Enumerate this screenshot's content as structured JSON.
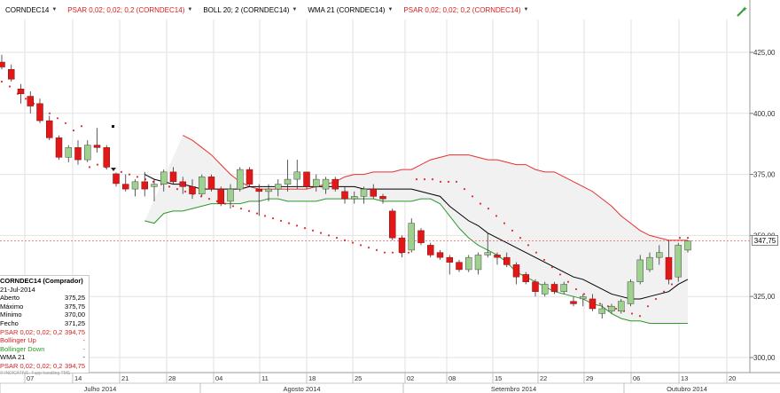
{
  "toolbar": {
    "items": [
      {
        "label": "CORNDEC14",
        "color": "#000000"
      },
      {
        "label": "PSAR 0,02; 0,02; 0,2 (CORNDEC14)",
        "color": "#d42020"
      },
      {
        "label": "BOLL 20; 2 (CORNDEC14)",
        "color": "#000000"
      },
      {
        "label": "WMA 21 (CORNDEC14)",
        "color": "#000000"
      },
      {
        "label": "PSAR 0,02; 0,02; 0,2 (CORNDEC14)",
        "color": "#d42020"
      }
    ],
    "wand_icon": "magic-wand-icon"
  },
  "info_panel": {
    "title": "CORNDEC14 (Comprador)",
    "date": "21-Jul-2014",
    "rows": [
      {
        "label": "Aberto",
        "value": "375,25",
        "color": "#000000"
      },
      {
        "label": "Máximo",
        "value": "375,75",
        "color": "#000000"
      },
      {
        "label": "Mínimo",
        "value": "370,00",
        "color": "#000000"
      },
      {
        "label": "Fecho",
        "value": "371,25",
        "color": "#000000"
      },
      {
        "label": "PSAR 0,02; 0,02; 0,2",
        "value": "394,75",
        "color": "#d42020"
      },
      {
        "label": "Bollinger Up",
        "value": "-",
        "color": "#d42020"
      },
      {
        "label": "Bollinger Down",
        "value": "-",
        "color": "#2a9a2a"
      },
      {
        "label": "WMA 21",
        "value": "-",
        "color": "#000000"
      },
      {
        "label": "PSAR 0,02; 0,02; 0,2",
        "value": "394,75",
        "color": "#d42020"
      }
    ]
  },
  "watermark": "© INDICATIVE. Fupp handling TMS",
  "last_price": "347,75",
  "colors": {
    "up": "#9ed08e",
    "down": "#e01818",
    "boll_up": "#e83030",
    "boll_down": "#2a9a2a",
    "wma": "#000000",
    "psar": "#e03030",
    "band_fill": "#f1f1f1",
    "grid": "#e2e2e2"
  },
  "chart_data": {
    "type": "candlestick",
    "symbol": "CORNDEC14",
    "y_axis": {
      "min": 300,
      "max": 425,
      "ticks": [
        "300,00",
        "325,00",
        "350,00",
        "375,00",
        "400,00",
        "425,00"
      ],
      "tick_values": [
        300,
        325,
        350,
        375,
        400,
        425
      ],
      "position": "right"
    },
    "x_axis": {
      "day_ticks": [
        "07",
        "14",
        "21",
        "28",
        "04",
        "11",
        "18",
        "25",
        "02",
        "08",
        "15",
        "22",
        "29",
        "06",
        "13",
        "20"
      ],
      "months": [
        "Julho 2014",
        "Agosto 2014",
        "Setembro 2014",
        "Outubro 2014"
      ]
    },
    "candles": [
      {
        "o": 421,
        "h": 424,
        "l": 418,
        "c": 419
      },
      {
        "o": 418,
        "h": 420,
        "l": 413,
        "c": 414
      },
      {
        "o": 410,
        "h": 412,
        "l": 404,
        "c": 408
      },
      {
        "o": 407,
        "h": 409,
        "l": 400,
        "c": 403
      },
      {
        "o": 404,
        "h": 406,
        "l": 396,
        "c": 397
      },
      {
        "o": 397,
        "h": 399,
        "l": 389,
        "c": 390
      },
      {
        "o": 390,
        "h": 391,
        "l": 381,
        "c": 382
      },
      {
        "o": 382,
        "h": 387,
        "l": 380,
        "c": 386
      },
      {
        "o": 386,
        "h": 389,
        "l": 379,
        "c": 381
      },
      {
        "o": 381,
        "h": 389,
        "l": 380,
        "c": 387
      },
      {
        "o": 387,
        "h": 394,
        "l": 384,
        "c": 386
      },
      {
        "o": 386,
        "h": 387,
        "l": 377,
        "c": 378
      },
      {
        "o": 375.25,
        "h": 375.75,
        "l": 370,
        "c": 371.25
      },
      {
        "o": 371,
        "h": 375,
        "l": 368,
        "c": 369
      },
      {
        "o": 369,
        "h": 373,
        "l": 366,
        "c": 372
      },
      {
        "o": 372,
        "h": 376,
        "l": 366,
        "c": 369
      },
      {
        "o": 370,
        "h": 373,
        "l": 364,
        "c": 371
      },
      {
        "o": 371,
        "h": 377,
        "l": 368,
        "c": 376
      },
      {
        "o": 376,
        "h": 378,
        "l": 371,
        "c": 372
      },
      {
        "o": 372,
        "h": 374,
        "l": 367,
        "c": 370
      },
      {
        "o": 370,
        "h": 373,
        "l": 365,
        "c": 367
      },
      {
        "o": 367,
        "h": 375,
        "l": 366,
        "c": 374
      },
      {
        "o": 374,
        "h": 375,
        "l": 368,
        "c": 369
      },
      {
        "o": 369,
        "h": 370,
        "l": 362,
        "c": 363
      },
      {
        "o": 364,
        "h": 371,
        "l": 361,
        "c": 369
      },
      {
        "o": 369,
        "h": 378,
        "l": 368,
        "c": 377
      },
      {
        "o": 377,
        "h": 378,
        "l": 370,
        "c": 371
      },
      {
        "o": 369,
        "h": 371,
        "l": 358,
        "c": 368
      },
      {
        "o": 368,
        "h": 371,
        "l": 364,
        "c": 369
      },
      {
        "o": 369,
        "h": 373,
        "l": 366,
        "c": 371
      },
      {
        "o": 371,
        "h": 381,
        "l": 368,
        "c": 373
      },
      {
        "o": 373,
        "h": 381,
        "l": 369,
        "c": 376
      },
      {
        "o": 376,
        "h": 376,
        "l": 369,
        "c": 370
      },
      {
        "o": 370,
        "h": 375,
        "l": 368,
        "c": 373
      },
      {
        "o": 369,
        "h": 374,
        "l": 367,
        "c": 373
      },
      {
        "o": 373,
        "h": 374,
        "l": 368,
        "c": 369
      },
      {
        "o": 368,
        "h": 370,
        "l": 363,
        "c": 365
      },
      {
        "o": 365,
        "h": 368,
        "l": 363,
        "c": 366
      },
      {
        "o": 366,
        "h": 370,
        "l": 363,
        "c": 369
      },
      {
        "o": 369,
        "h": 371,
        "l": 365,
        "c": 366
      },
      {
        "o": 366,
        "h": 367,
        "l": 363,
        "c": 365
      },
      {
        "o": 360,
        "h": 361,
        "l": 348,
        "c": 349
      },
      {
        "o": 349,
        "h": 350,
        "l": 341,
        "c": 343
      },
      {
        "o": 344,
        "h": 357,
        "l": 343,
        "c": 355
      },
      {
        "o": 352,
        "h": 353,
        "l": 346,
        "c": 347
      },
      {
        "o": 346,
        "h": 347,
        "l": 341,
        "c": 342
      },
      {
        "o": 343,
        "h": 344,
        "l": 340,
        "c": 341
      },
      {
        "o": 341,
        "h": 342,
        "l": 334,
        "c": 339
      },
      {
        "o": 339,
        "h": 340,
        "l": 335,
        "c": 336
      },
      {
        "o": 336,
        "h": 342,
        "l": 335,
        "c": 341
      },
      {
        "o": 336,
        "h": 343,
        "l": 334,
        "c": 342
      },
      {
        "o": 342,
        "h": 351,
        "l": 341,
        "c": 343
      },
      {
        "o": 342,
        "h": 343,
        "l": 338,
        "c": 341
      },
      {
        "o": 341,
        "h": 343,
        "l": 337,
        "c": 338
      },
      {
        "o": 338,
        "h": 339,
        "l": 330,
        "c": 333
      },
      {
        "o": 334,
        "h": 335,
        "l": 330,
        "c": 331
      },
      {
        "o": 331,
        "h": 332,
        "l": 325,
        "c": 327
      },
      {
        "o": 326,
        "h": 331,
        "l": 325,
        "c": 330
      },
      {
        "o": 330,
        "h": 331,
        "l": 326,
        "c": 327
      },
      {
        "o": 327,
        "h": 331,
        "l": 326,
        "c": 330
      },
      {
        "o": 323,
        "h": 325,
        "l": 321,
        "c": 322
      },
      {
        "o": 324,
        "h": 326,
        "l": 321,
        "c": 325
      },
      {
        "o": 324,
        "h": 326,
        "l": 319,
        "c": 320
      },
      {
        "o": 318,
        "h": 322,
        "l": 316,
        "c": 320
      },
      {
        "o": 319,
        "h": 322,
        "l": 318,
        "c": 321
      },
      {
        "o": 319,
        "h": 324,
        "l": 318,
        "c": 323
      },
      {
        "o": 322,
        "h": 332,
        "l": 321,
        "c": 331
      },
      {
        "o": 331,
        "h": 342,
        "l": 330,
        "c": 340
      },
      {
        "o": 336,
        "h": 343,
        "l": 335,
        "c": 341
      },
      {
        "o": 341,
        "h": 346,
        "l": 338,
        "c": 343
      },
      {
        "o": 341,
        "h": 348,
        "l": 330,
        "c": 332
      },
      {
        "o": 333,
        "h": 347,
        "l": 331,
        "c": 346
      },
      {
        "o": 344,
        "h": 348,
        "l": 343,
        "c": 347.75
      }
    ],
    "bollinger_up": [
      391,
      389,
      386,
      383,
      379,
      375,
      372,
      370,
      369,
      369,
      369,
      369,
      369,
      369,
      370,
      371,
      372,
      374,
      375,
      375,
      376,
      376,
      376,
      377,
      377,
      379,
      381,
      382,
      383,
      383,
      383,
      382,
      381,
      381,
      380,
      379,
      379,
      377,
      376,
      376,
      374,
      372,
      370,
      368,
      365,
      362,
      358,
      355,
      352,
      350,
      349,
      348,
      348,
      348
    ],
    "bollinger_down": [
      356,
      355,
      359,
      360,
      360,
      361,
      362,
      363,
      363,
      363,
      363,
      364,
      364,
      365,
      365,
      364,
      364,
      364,
      364,
      365,
      365,
      365,
      365,
      365,
      365,
      364,
      364,
      364,
      364,
      365,
      365,
      363,
      358,
      353,
      349,
      346,
      344,
      342,
      339,
      335,
      333,
      331,
      329,
      327,
      326,
      325,
      324,
      322,
      321,
      318,
      316,
      315,
      315,
      314,
      314,
      314,
      314,
      314
    ],
    "wma_21": [
      375,
      373,
      372,
      371,
      371,
      370,
      369,
      369,
      369,
      369,
      369,
      370,
      370,
      370,
      370,
      370,
      370,
      370,
      370,
      370,
      370,
      370,
      370,
      369,
      369,
      369,
      369,
      369,
      369,
      368,
      367,
      366,
      362,
      359,
      356,
      354,
      351,
      349,
      347,
      345,
      343,
      341,
      339,
      337,
      335,
      333,
      332,
      330,
      328,
      326,
      325,
      324,
      324,
      325,
      326,
      327,
      330,
      332
    ],
    "psar": [
      413,
      411,
      408,
      406,
      404,
      402,
      400,
      398,
      396,
      393,
      394.75,
      378,
      379,
      378,
      377,
      376,
      375,
      374,
      373,
      372,
      371,
      370,
      369,
      368,
      367,
      366,
      365,
      364,
      363,
      362,
      361,
      360,
      359,
      358,
      357,
      356,
      355,
      354,
      353,
      352,
      351,
      350,
      349,
      348,
      347,
      346,
      345,
      344,
      343,
      343,
      343,
      343,
      373,
      373,
      373,
      372,
      372,
      372,
      369,
      366,
      363,
      361,
      358,
      355,
      352,
      349,
      346,
      343,
      340,
      337,
      334,
      331,
      328,
      326,
      323,
      322,
      321,
      320,
      319,
      318,
      317,
      321,
      324,
      327,
      330,
      349,
      349
    ]
  }
}
